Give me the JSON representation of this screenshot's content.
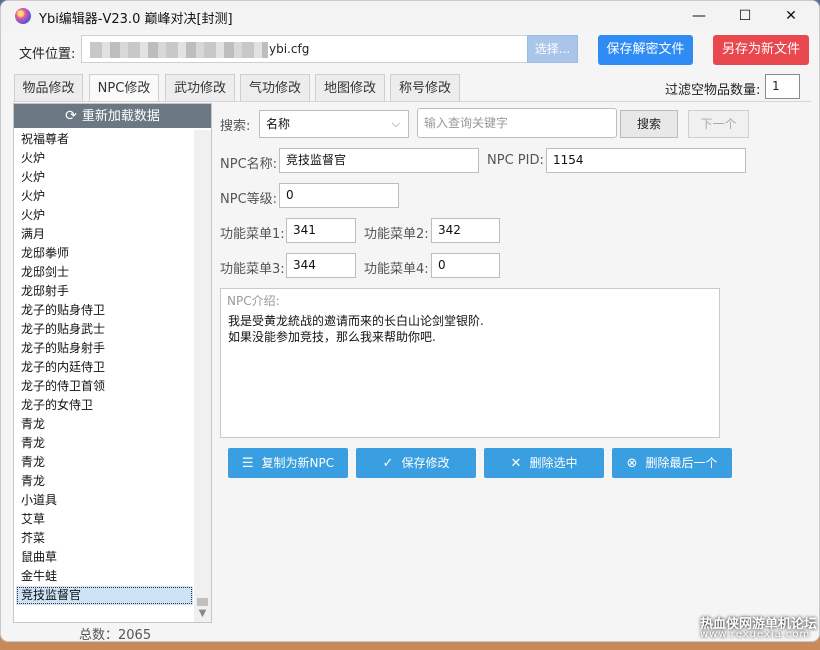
{
  "window": {
    "title": "Ybi编辑器-V23.0 巅峰对决[封测]",
    "minimize": "—",
    "maximize": "☐",
    "close": "✕"
  },
  "file": {
    "label": "文件位置:",
    "path_suffix": "ybi.cfg",
    "choose_label": "选择...",
    "save_decrypt_label": "保存解密文件",
    "save_as_label": "另存为新文件"
  },
  "tabs": [
    {
      "label": "物品修改"
    },
    {
      "label": "NPC修改"
    },
    {
      "label": "武功修改"
    },
    {
      "label": "气功修改"
    },
    {
      "label": "地图修改"
    },
    {
      "label": "称号修改"
    }
  ],
  "filter": {
    "label": "过滤空物品数量:",
    "value": "1"
  },
  "left": {
    "reload_label": "重新加载数据",
    "items": [
      "祝福尊者",
      "火炉",
      "火炉",
      "火炉",
      "火炉",
      "满月",
      "龙邸拳师",
      "龙邸剑士",
      "龙邸射手",
      "龙子的贴身侍卫",
      "龙子的贴身武士",
      "龙子的贴身射手",
      "龙子的内廷侍卫",
      "龙子的侍卫首领",
      "龙子的女侍卫",
      "青龙",
      "青龙",
      "青龙",
      "青龙",
      "小道具",
      "艾草",
      "芥菜",
      "鼠曲草",
      "金牛蛙",
      "竞技监督官"
    ],
    "total": "总数：2065"
  },
  "search": {
    "label": "搜索:",
    "field_value": "名称",
    "keyword_placeholder": "输入查询关键字",
    "search_btn": "搜索",
    "next_btn": "下一个"
  },
  "npc": {
    "name_label": "NPC名称:",
    "name": "竞技监督官",
    "pid_label": "NPC PID:",
    "pid": "1154",
    "level_label": "NPC等级:",
    "level": "0",
    "menu1_label": "功能菜单1:",
    "menu1": "341",
    "menu2_label": "功能菜单2:",
    "menu2": "342",
    "menu3_label": "功能菜单3:",
    "menu3": "344",
    "menu4_label": "功能菜单4:",
    "menu4": "0",
    "intro_label": "NPC介绍:",
    "intro_line1": "我是受黄龙統战的邀请而来的长白山论剑堂银阶.",
    "intro_line2": "如果没能参加竞技，那么我来帮助你吧."
  },
  "actions": {
    "copy": "复制为新NPC",
    "save": "保存修改",
    "delete_selected": "删除选中",
    "delete_last": "删除最后一个"
  },
  "watermark": {
    "line1": "热血侠网游单机论坛",
    "line2": "www.rexuexia.com"
  }
}
